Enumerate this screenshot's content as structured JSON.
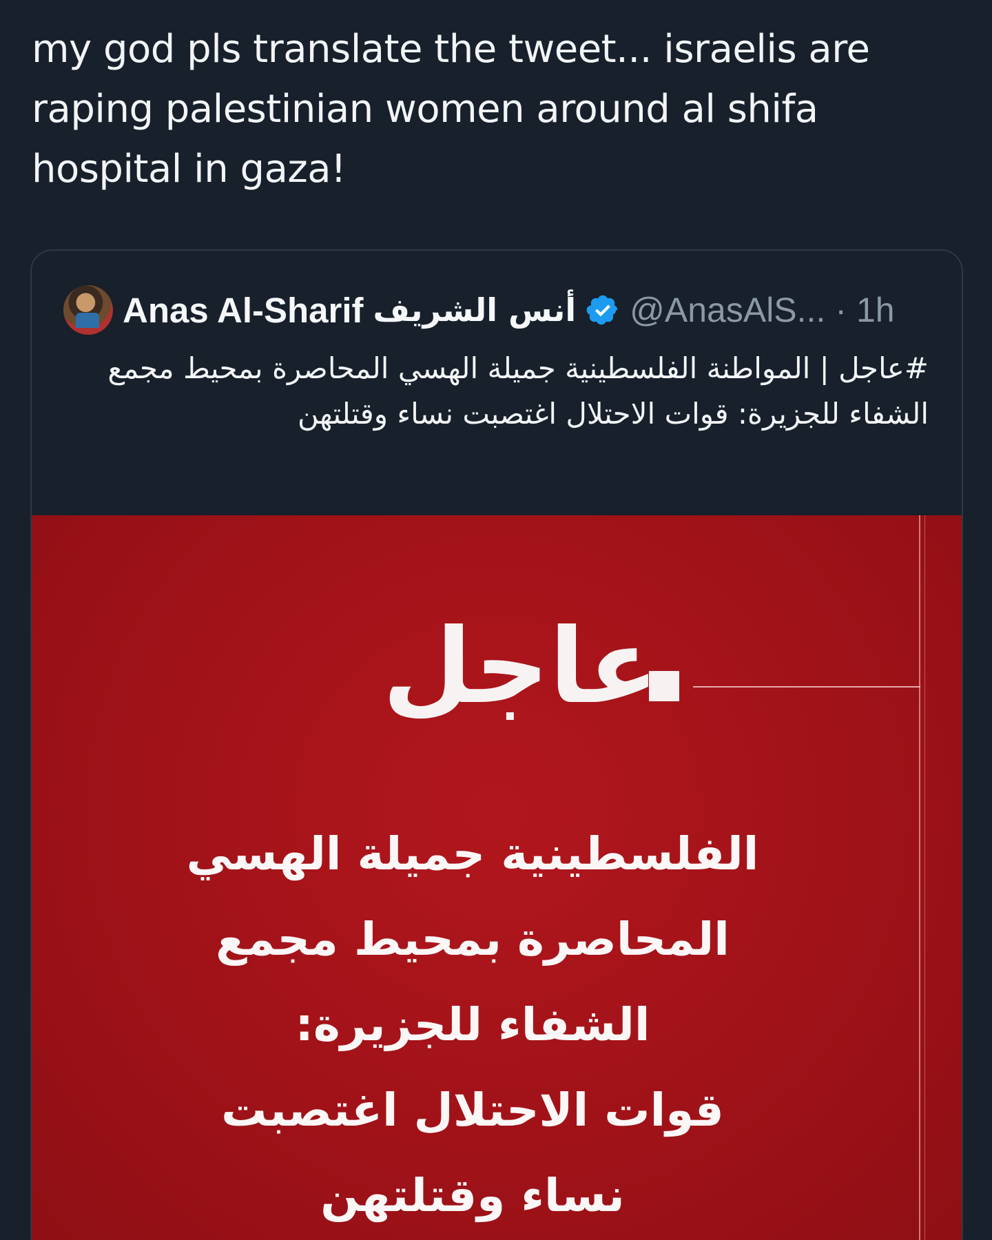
{
  "post": {
    "text": "my god pls translate the tweet... israelis are raping palestinian women around al shifa hospital in gaza!"
  },
  "quoted_tweet": {
    "author_name": "Anas Al-Sharif",
    "author_name_arabic": "أنس الشريف",
    "verified": true,
    "handle": "@AnasAlS...",
    "separator": "·",
    "time": "1h",
    "text": "#عاجل | المواطنة الفلسطينية جميلة الهسي المحاصرة بمحيط مجمع الشفاء للجزيرة: قوات الاحتلال اغتصبت نساء وقتلتهن",
    "media": {
      "headline": "عاجل",
      "lines": [
        "الفلسطينية جميلة الهسي",
        "المحاصرة بمحيط مجمع",
        "الشفاء للجزيرة:",
        "قوات الاحتلال اغتصبت",
        "نساء وقتلتهن"
      ]
    }
  },
  "colors": {
    "background": "#17202b",
    "text_primary": "#f3f5f7",
    "text_secondary": "#8b98a5",
    "verified": "#1d9bf0",
    "media_red": "#a3131a",
    "card_border": "#2f3944"
  },
  "icons": {
    "verified": "verified-badge-icon"
  }
}
